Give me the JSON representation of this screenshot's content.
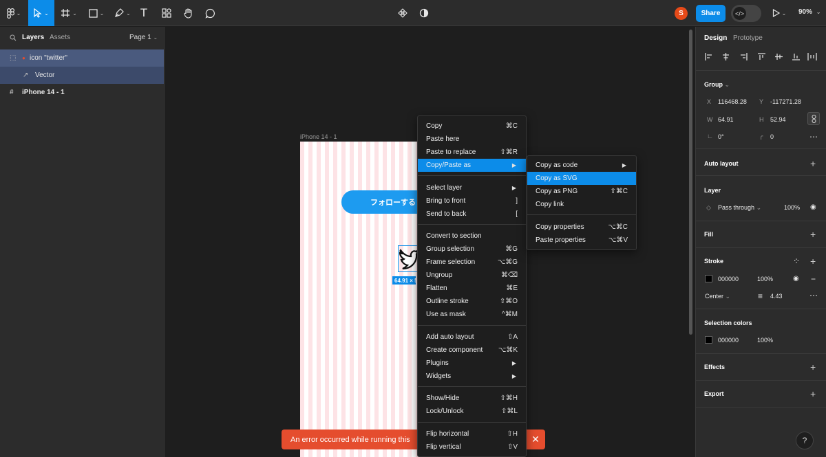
{
  "toolbar": {
    "caret": "⌄",
    "text_tool": "T",
    "avatar_letter": "S",
    "share_label": "Share",
    "dev_mode_icon": "</>",
    "zoom_label": "90%",
    "zoom_caret": "⌄"
  },
  "left_panel": {
    "tabs": {
      "layers": "Layers",
      "assets": "Assets"
    },
    "page_label": "Page 1",
    "page_caret": "⌄",
    "layers": [
      {
        "label": "icon \"twitter\"",
        "icon": "⬚"
      },
      {
        "label": "Vector",
        "icon": "↗"
      },
      {
        "label": "iPhone 14 - 1",
        "icon": "#"
      }
    ]
  },
  "canvas": {
    "frame_label": "iPhone 14 - 1",
    "follow_button": "フォローする",
    "size_badge": "64.91 × 52.94"
  },
  "toast": {
    "message": "An error occurred while running this",
    "close": "✕"
  },
  "context_menu": {
    "groups": [
      [
        {
          "label": "Copy",
          "shortcut": "⌘C"
        },
        {
          "label": "Paste here",
          "shortcut": ""
        },
        {
          "label": "Paste to replace",
          "shortcut": "⇧⌘R"
        },
        {
          "label": "Copy/Paste as",
          "shortcut": "",
          "submenu": true,
          "highlighted": true
        }
      ],
      [
        {
          "label": "Select layer",
          "shortcut": "",
          "submenu": true
        },
        {
          "label": "Bring to front",
          "shortcut": "]"
        },
        {
          "label": "Send to back",
          "shortcut": "["
        }
      ],
      [
        {
          "label": "Convert to section",
          "shortcut": ""
        },
        {
          "label": "Group selection",
          "shortcut": "⌘G"
        },
        {
          "label": "Frame selection",
          "shortcut": "⌥⌘G"
        },
        {
          "label": "Ungroup",
          "shortcut": "⌘⌫"
        },
        {
          "label": "Flatten",
          "shortcut": "⌘E"
        },
        {
          "label": "Outline stroke",
          "shortcut": "⇧⌘O"
        },
        {
          "label": "Use as mask",
          "shortcut": "^⌘M"
        }
      ],
      [
        {
          "label": "Add auto layout",
          "shortcut": "⇧A"
        },
        {
          "label": "Create component",
          "shortcut": "⌥⌘K"
        },
        {
          "label": "Plugins",
          "shortcut": "",
          "submenu": true
        },
        {
          "label": "Widgets",
          "shortcut": "",
          "submenu": true
        }
      ],
      [
        {
          "label": "Show/Hide",
          "shortcut": "⇧⌘H"
        },
        {
          "label": "Lock/Unlock",
          "shortcut": "⇧⌘L"
        }
      ],
      [
        {
          "label": "Flip horizontal",
          "shortcut": "⇧H"
        },
        {
          "label": "Flip vertical",
          "shortcut": "⇧V"
        }
      ]
    ],
    "arrow": "▶"
  },
  "submenu": {
    "groups": [
      [
        {
          "label": "Copy as code",
          "shortcut": "",
          "submenu": true
        },
        {
          "label": "Copy as SVG",
          "shortcut": "",
          "highlighted": true
        },
        {
          "label": "Copy as PNG",
          "shortcut": "⇧⌘C"
        },
        {
          "label": "Copy link",
          "shortcut": ""
        }
      ],
      [
        {
          "label": "Copy properties",
          "shortcut": "⌥⌘C"
        },
        {
          "label": "Paste properties",
          "shortcut": "⌥⌘V"
        }
      ]
    ]
  },
  "right_panel": {
    "tabs": {
      "design": "Design",
      "prototype": "Prototype"
    },
    "group": {
      "title": "Group",
      "caret": "⌄",
      "x_label": "X",
      "x_value": "116468.28",
      "y_label": "Y",
      "y_value": "-117271.28",
      "w_label": "W",
      "w_value": "64.91",
      "h_label": "H",
      "h_value": "52.94",
      "rotation_icon": "∟",
      "rotation_value": "0°",
      "radius_icon": "╭",
      "radius_value": "0",
      "more": "⋯"
    },
    "auto_layout": {
      "title": "Auto layout",
      "add": "+"
    },
    "layer": {
      "title": "Layer",
      "blend_icon": "◇",
      "blend_mode": "Pass through",
      "blend_caret": "⌄",
      "opacity": "100%",
      "visibility_icon": "◉"
    },
    "fill": {
      "title": "Fill",
      "add": "+"
    },
    "stroke": {
      "title": "Stroke",
      "styles_icon": "⁘",
      "add": "+",
      "color_hex": "000000",
      "opacity": "100%",
      "visibility_icon": "◉",
      "remove": "−",
      "position": "Center",
      "position_caret": "⌄",
      "weight_icon": "≡",
      "weight": "4.43",
      "more": "⋯"
    },
    "selection_colors": {
      "title": "Selection colors",
      "color_hex": "000000",
      "opacity": "100%"
    },
    "effects": {
      "title": "Effects",
      "add": "+"
    },
    "export": {
      "title": "Export",
      "add": "+"
    }
  },
  "help": "?",
  "colors": {
    "accent": "#0c8ce9",
    "error": "#e54d2e",
    "twitter_blue": "#1d9bf0",
    "panel": "#2c2c2c",
    "canvas": "#1e1e1e"
  }
}
